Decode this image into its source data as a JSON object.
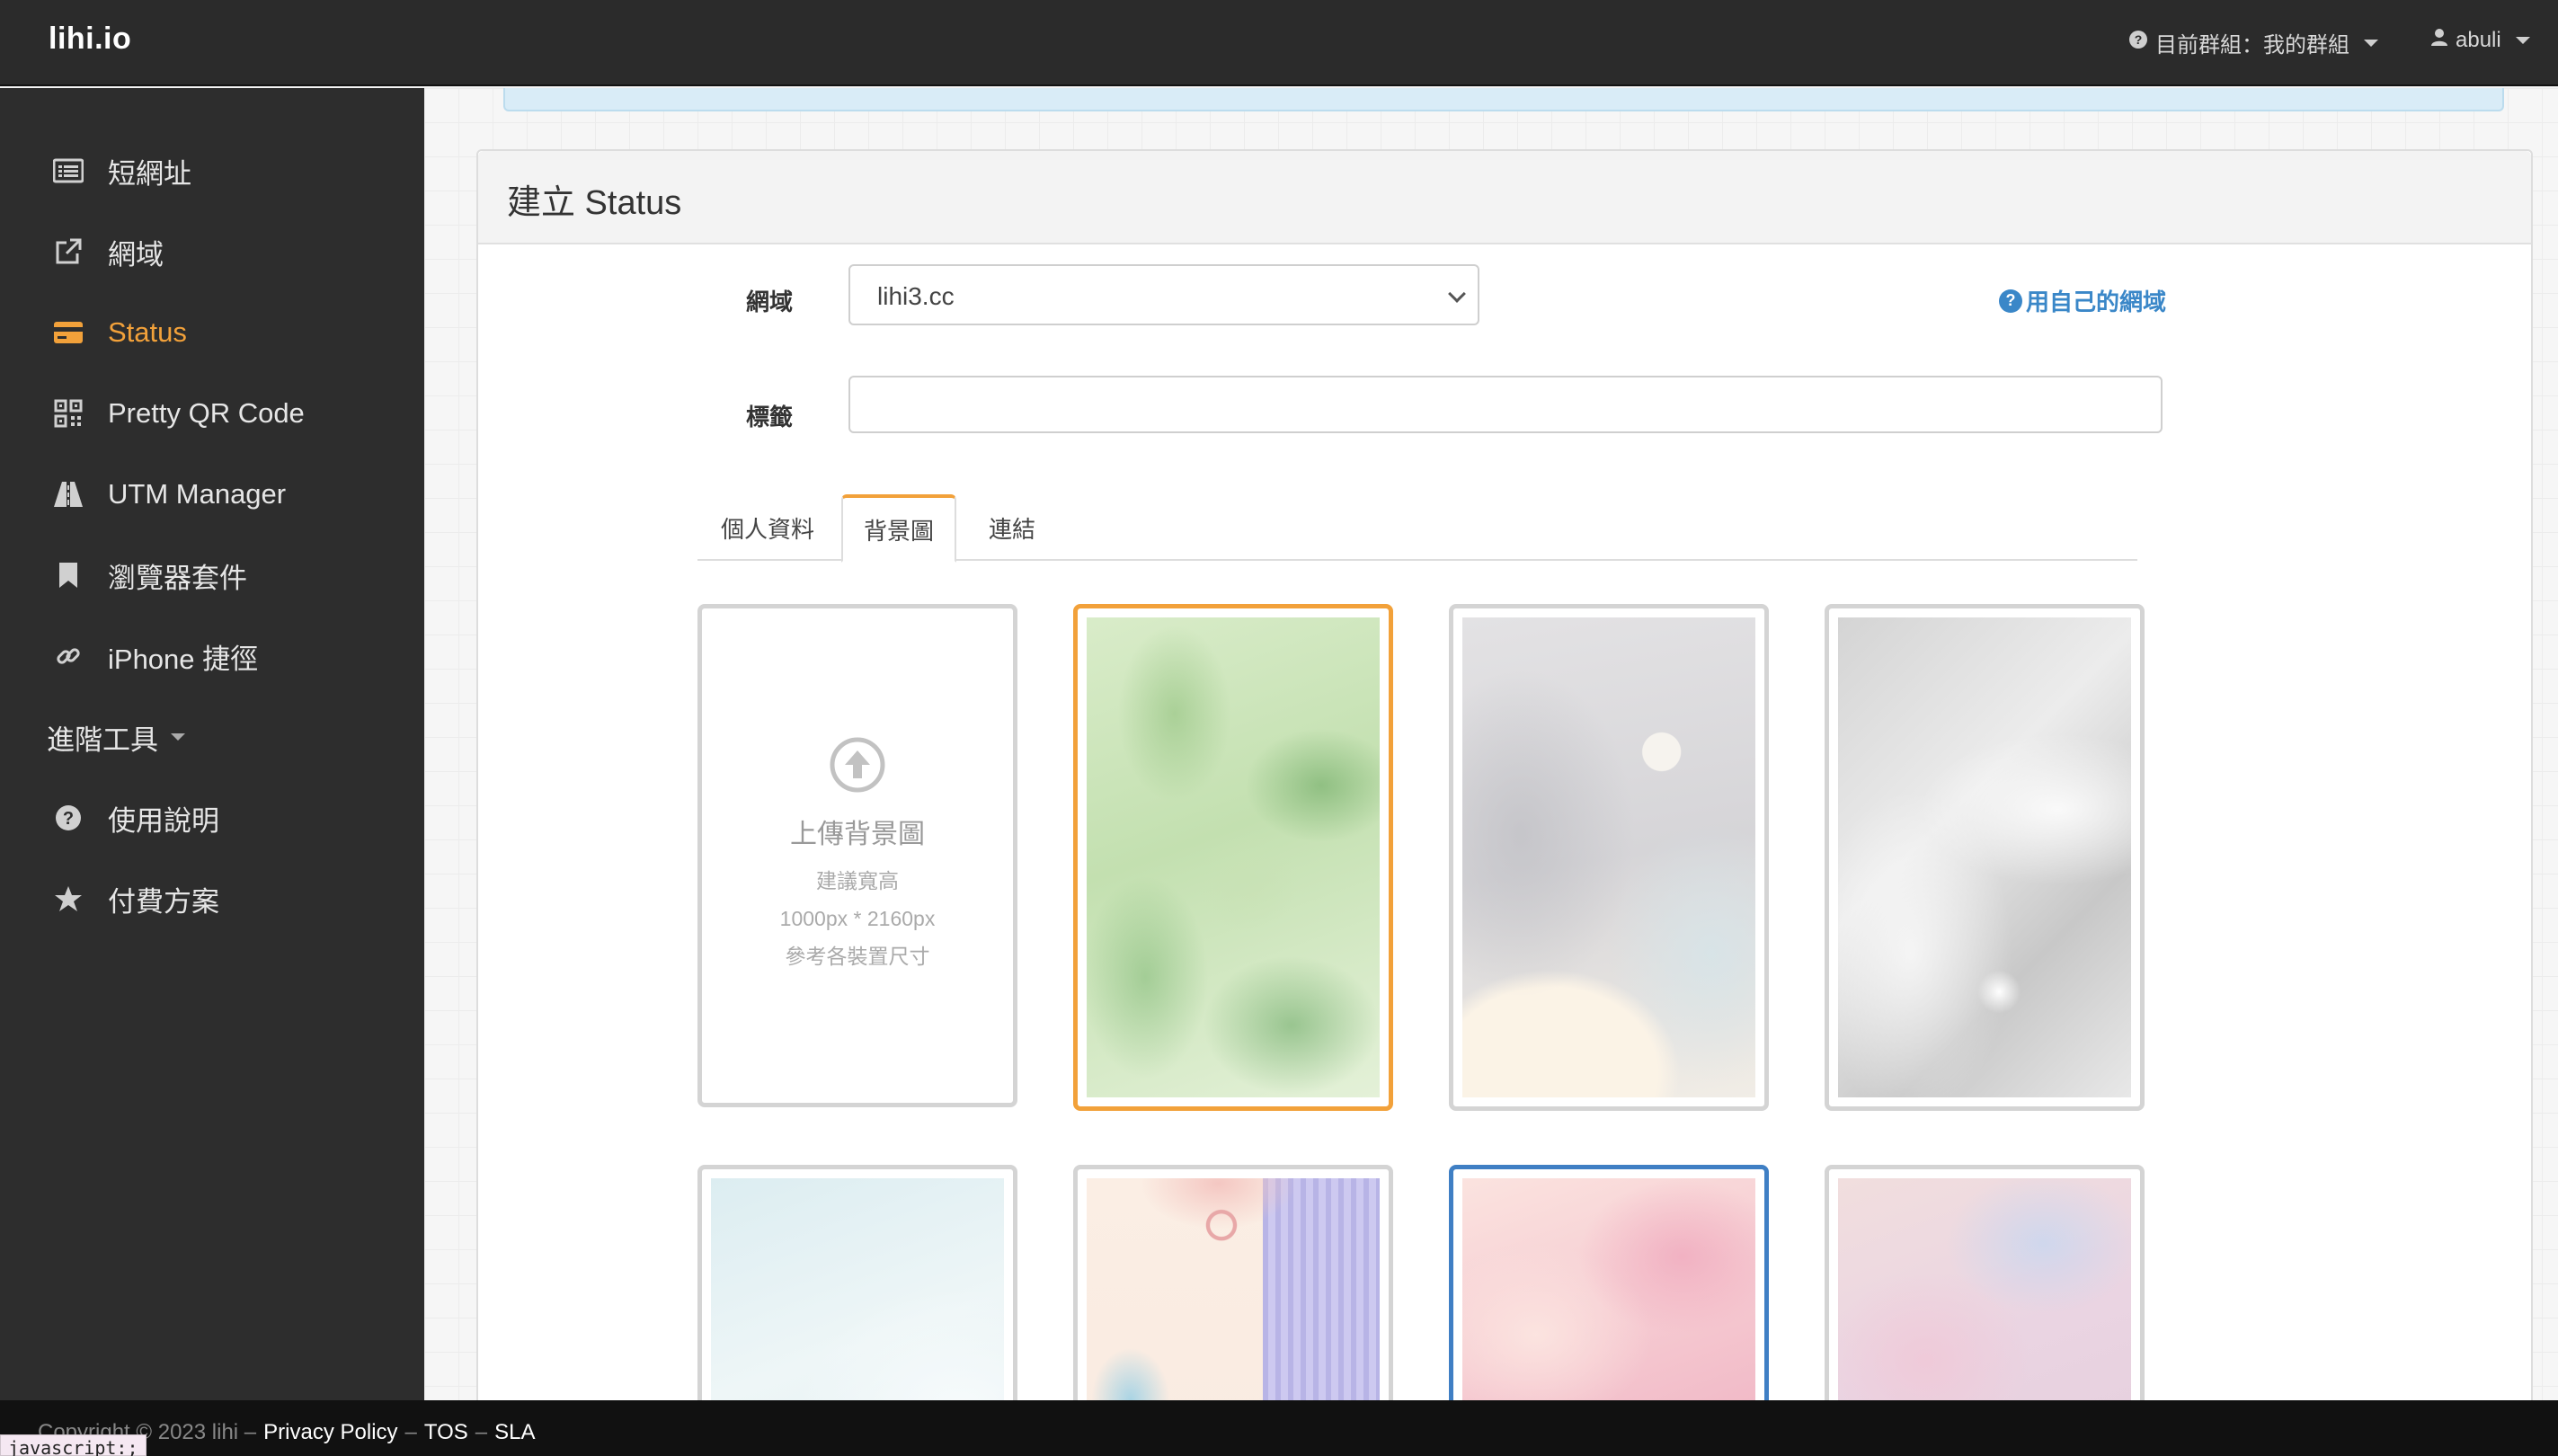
{
  "topbar": {
    "brand": "lihi.io",
    "group_label": "目前群組：我的群組",
    "username": "abuli"
  },
  "sidebar": {
    "items": [
      {
        "label": "短網址",
        "icon": "list-icon"
      },
      {
        "label": "網域",
        "icon": "external-link-icon"
      },
      {
        "label": "Status",
        "icon": "credit-card-icon",
        "active": true
      },
      {
        "label": "Pretty QR Code",
        "icon": "qrcode-icon"
      },
      {
        "label": "UTM Manager",
        "icon": "road-icon"
      },
      {
        "label": "瀏覽器套件",
        "icon": "bookmark-icon"
      },
      {
        "label": "iPhone 捷徑",
        "icon": "link-icon"
      },
      {
        "label": "進階工具",
        "icon": "",
        "dropdown": true
      },
      {
        "label": "使用說明",
        "icon": "question-circle-icon"
      },
      {
        "label": "付費方案",
        "icon": "star-icon"
      }
    ]
  },
  "panel": {
    "title": "建立 Status",
    "domain_label": "網域",
    "domain_value": "lihi3.cc",
    "own_domain_link": "用自己的網域",
    "tag_label": "標籤",
    "tag_value": ""
  },
  "tabs": [
    {
      "label": "個人資料",
      "active": false
    },
    {
      "label": "背景圖",
      "active": true
    },
    {
      "label": "連結",
      "active": false
    }
  ],
  "upload": {
    "title": "上傳背景圖",
    "hint_line1": "建議寬高",
    "hint_line2": "1000px * 2160px",
    "hint_line3": "參考各裝置尺寸"
  },
  "backgrounds": [
    {
      "name": "green-watercolor",
      "selected": true
    },
    {
      "name": "grey-waves"
    },
    {
      "name": "silver-swirl"
    },
    {
      "name": "pale-blue-curve"
    },
    {
      "name": "pastel-geometric"
    },
    {
      "name": "pink-clouds",
      "hover": true
    },
    {
      "name": "pink-blue-watercolor"
    }
  ],
  "footer": {
    "copyright": "Copyright © 2023 lihi –",
    "privacy": "Privacy Policy",
    "sep1": "–",
    "tos": "TOS",
    "sep2": "–",
    "sla": "SLA"
  },
  "status_bar": "javascript:;",
  "colors": {
    "accent": "#f2a13a",
    "link": "#3a87c8",
    "sidebar_bg": "#2d2d2d",
    "topbar_bg": "#2b2b2b"
  }
}
